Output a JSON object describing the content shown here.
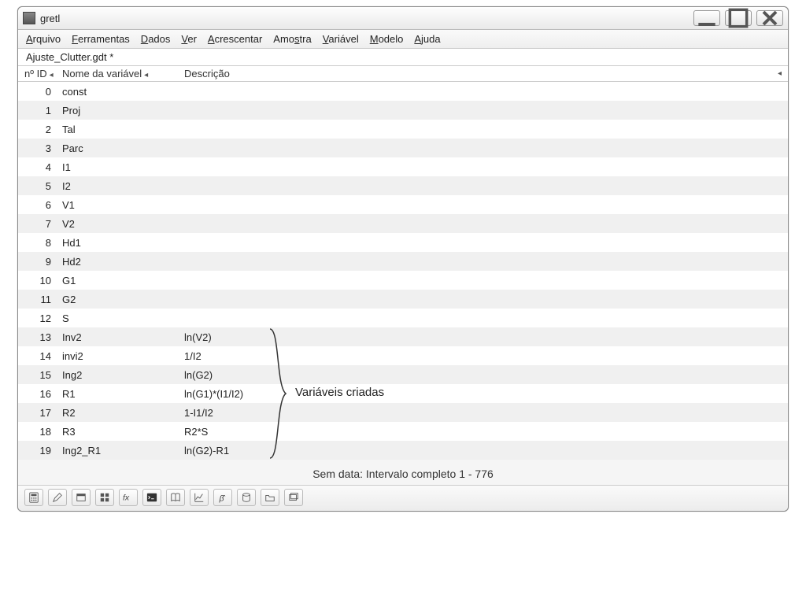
{
  "window": {
    "title": "gretl"
  },
  "menu": [
    {
      "label": "Arquivo",
      "hotkey_index": 0
    },
    {
      "label": "Ferramentas",
      "hotkey_index": 0
    },
    {
      "label": "Dados",
      "hotkey_index": 0
    },
    {
      "label": "Ver",
      "hotkey_index": 0
    },
    {
      "label": "Acrescentar",
      "hotkey_index": 0
    },
    {
      "label": "Amostra",
      "hotkey_index": 3
    },
    {
      "label": "Variável",
      "hotkey_index": 0
    },
    {
      "label": "Modelo",
      "hotkey_index": 0
    },
    {
      "label": "Ajuda",
      "hotkey_index": 0
    }
  ],
  "filename": "Ajuste_Clutter.gdt *",
  "columns": {
    "id": "nº ID",
    "name": "Nome da variável",
    "desc": "Descrição"
  },
  "variables": [
    {
      "id": 0,
      "name": "const",
      "desc": ""
    },
    {
      "id": 1,
      "name": "Proj",
      "desc": ""
    },
    {
      "id": 2,
      "name": "Tal",
      "desc": ""
    },
    {
      "id": 3,
      "name": "Parc",
      "desc": ""
    },
    {
      "id": 4,
      "name": "I1",
      "desc": ""
    },
    {
      "id": 5,
      "name": "I2",
      "desc": ""
    },
    {
      "id": 6,
      "name": "V1",
      "desc": ""
    },
    {
      "id": 7,
      "name": "V2",
      "desc": ""
    },
    {
      "id": 8,
      "name": "Hd1",
      "desc": ""
    },
    {
      "id": 9,
      "name": "Hd2",
      "desc": ""
    },
    {
      "id": 10,
      "name": "G1",
      "desc": ""
    },
    {
      "id": 11,
      "name": "G2",
      "desc": ""
    },
    {
      "id": 12,
      "name": "S",
      "desc": ""
    },
    {
      "id": 13,
      "name": "Inv2",
      "desc": "ln(V2)"
    },
    {
      "id": 14,
      "name": "invi2",
      "desc": "1/I2"
    },
    {
      "id": 15,
      "name": "Ing2",
      "desc": "ln(G2)"
    },
    {
      "id": 16,
      "name": "R1",
      "desc": "ln(G1)*(I1/I2)"
    },
    {
      "id": 17,
      "name": "R2",
      "desc": "1-I1/I2"
    },
    {
      "id": 18,
      "name": "R3",
      "desc": "R2*S"
    },
    {
      "id": 19,
      "name": "Ing2_R1",
      "desc": "ln(G2)-R1"
    }
  ],
  "annotation": {
    "label": "Variáveis criadas"
  },
  "status": "Sem data: Intervalo completo 1 - 776",
  "toolbar_icons": [
    "calculator",
    "edit",
    "window-new",
    "grid",
    "fx",
    "console",
    "book",
    "plot",
    "beta-hat",
    "database",
    "open-folder",
    "stack"
  ]
}
